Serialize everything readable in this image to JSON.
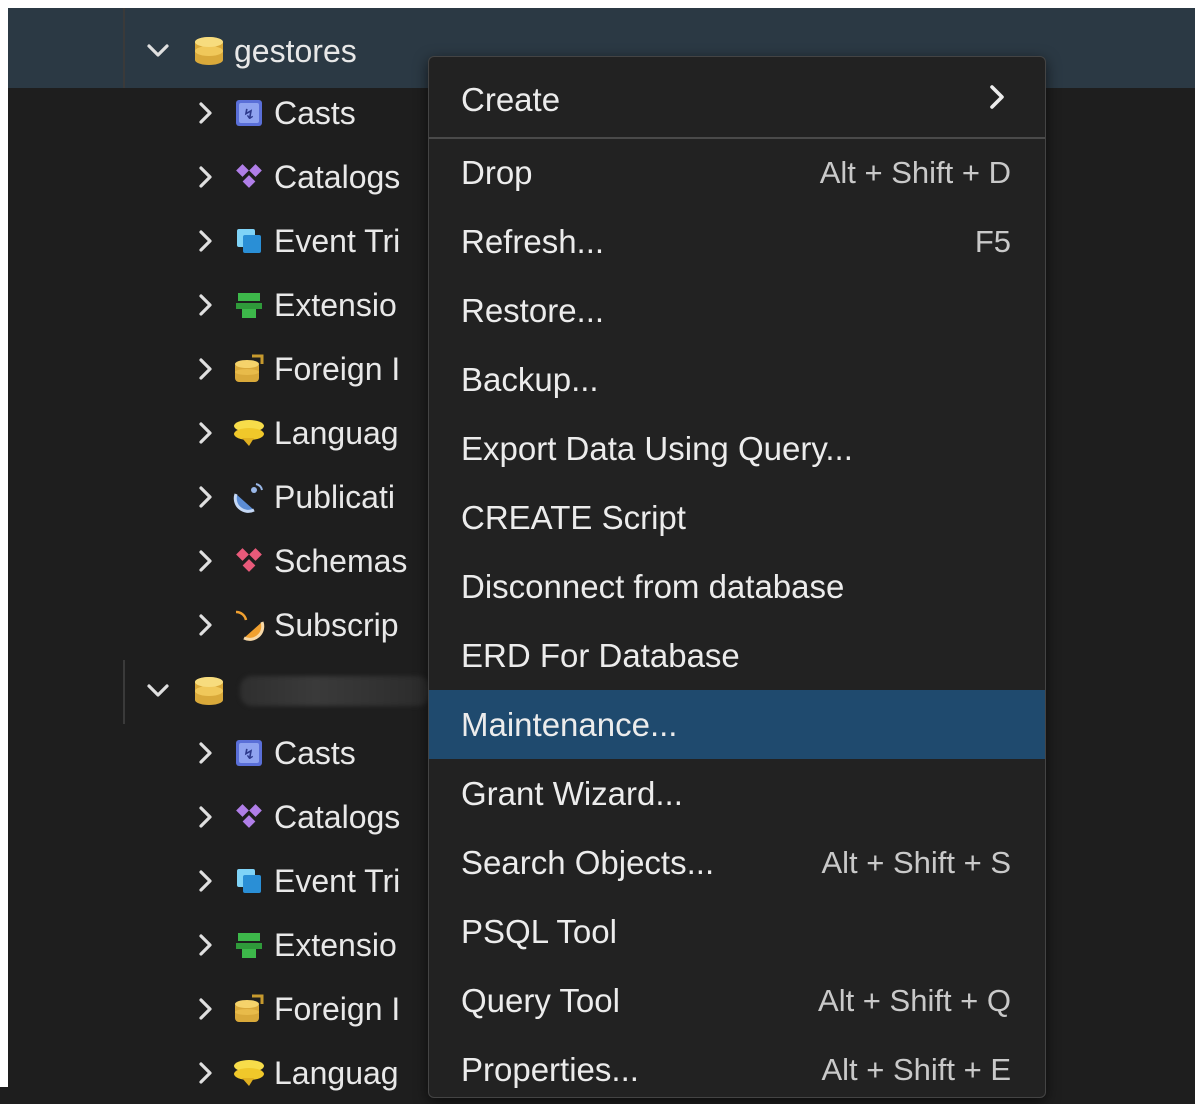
{
  "tree": {
    "db1": {
      "name": "gestores",
      "children": [
        "Casts",
        "Catalogs",
        "Event Tri",
        "Extensio",
        "Foreign I",
        "Languag",
        "Publicati",
        "Schemas",
        "Subscrip"
      ]
    },
    "db2": {
      "name": "",
      "children": [
        "Casts",
        "Catalogs",
        "Event Tri",
        "Extensio",
        "Foreign I",
        "Languag"
      ]
    },
    "icons": [
      "casts-icon",
      "catalogs-icon",
      "event-triggers-icon",
      "extensions-icon",
      "foreign-data-icon",
      "languages-icon",
      "publications-icon",
      "schemas-icon",
      "subscriptions-icon"
    ]
  },
  "context_menu": {
    "submenu": {
      "label": "Create",
      "arrow": "›"
    },
    "items": [
      {
        "label": "Drop",
        "shortcut": "Alt + Shift + D"
      },
      {
        "label": "Refresh...",
        "shortcut": "F5"
      },
      {
        "label": "Restore...",
        "shortcut": ""
      },
      {
        "label": "Backup...",
        "shortcut": ""
      },
      {
        "label": "Export Data Using Query...",
        "shortcut": ""
      },
      {
        "label": "CREATE Script",
        "shortcut": ""
      },
      {
        "label": "Disconnect from database",
        "shortcut": ""
      },
      {
        "label": "ERD For Database",
        "shortcut": ""
      },
      {
        "label": "Maintenance...",
        "shortcut": "",
        "highlighted": true
      },
      {
        "label": "Grant Wizard...",
        "shortcut": ""
      },
      {
        "label": "Search Objects...",
        "shortcut": "Alt + Shift + S"
      },
      {
        "label": "PSQL Tool",
        "shortcut": ""
      },
      {
        "label": "Query Tool",
        "shortcut": "Alt + Shift + Q"
      },
      {
        "label": "Properties...",
        "shortcut": "Alt + Shift + E"
      }
    ]
  },
  "colors": {
    "background": "#1e1e1e",
    "selected_row": "#2b3944",
    "menu_bg": "#222222",
    "menu_highlight": "#1f4a6e",
    "text": "#ececec"
  }
}
